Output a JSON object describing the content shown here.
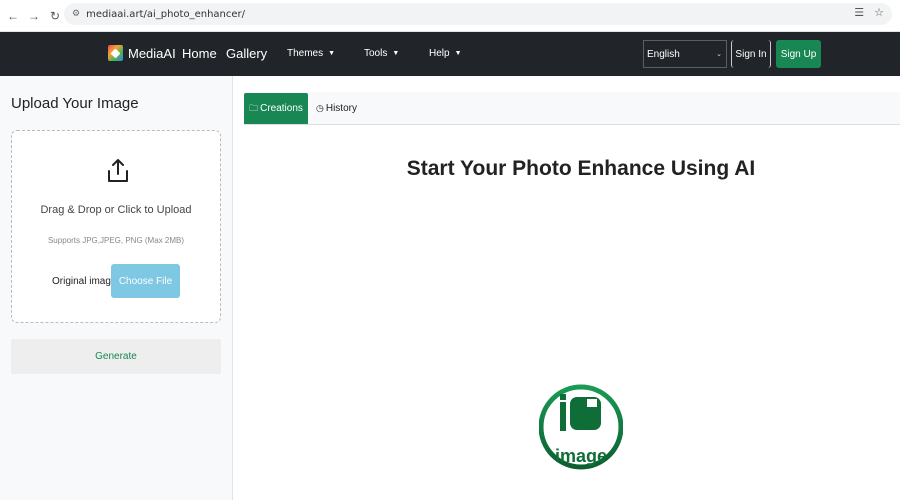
{
  "browser": {
    "url": "mediaai.art/ai_photo_enhancer/"
  },
  "nav": {
    "brand": "MediaAI",
    "links": [
      "Home",
      "Gallery"
    ],
    "dropdowns": [
      "Themes",
      "Tools",
      "Help"
    ],
    "language": "English",
    "sign_in": "Sign In",
    "sign_up": "Sign Up"
  },
  "upload": {
    "title": "Upload Your Image",
    "drop_text": "Drag & Drop or Click to Upload",
    "supports": "Supports JPG,JPEG, PNG (Max 2MB)",
    "original_label": "Original image",
    "choose_file": "Choose File",
    "generate": "Generate"
  },
  "tabs": [
    {
      "label": "Creations"
    },
    {
      "label": "History"
    }
  ],
  "main": {
    "heading": "Start Your Photo Enhance Using AI",
    "emblem_text": "image"
  },
  "colors": {
    "nav_bg": "#212529",
    "accent_green": "#198754",
    "choose_blue": "#7ec8e3"
  }
}
